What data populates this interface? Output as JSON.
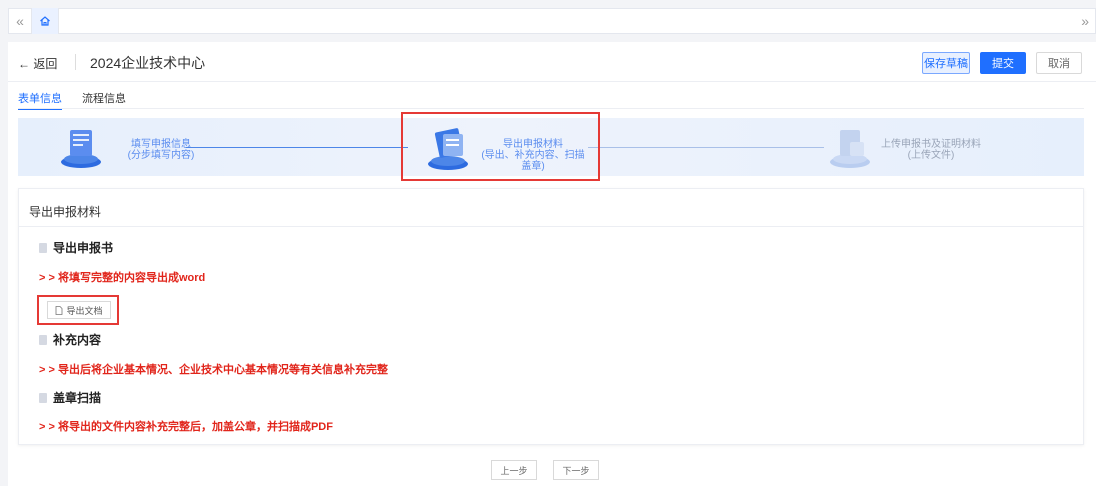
{
  "topbar": {
    "collapse_glyph": "«",
    "expand_glyph": "»"
  },
  "header": {
    "back_label": "← 返回",
    "title": "2024企业技术中心",
    "save_draft_label": "保存草稿",
    "submit_label": "提交",
    "cancel_label": "取消"
  },
  "tabs": [
    {
      "label": "表单信息",
      "active": true
    },
    {
      "label": "流程信息",
      "active": false
    }
  ],
  "steps": [
    {
      "title": "填写申报信息",
      "subtitle": "(分步填写内容)",
      "state": "done"
    },
    {
      "title": "导出申报材料",
      "subtitle": "(导出、补充内容、扫描盖章)",
      "state": "current"
    },
    {
      "title": "上传申报书及证明材料",
      "subtitle": "(上传文件)",
      "state": "pending"
    }
  ],
  "section": {
    "title": "导出申报材料",
    "items": [
      {
        "title": "导出申报书",
        "hint": "> > 将填写完整的内容导出成word"
      },
      {
        "title": "补充内容",
        "hint": "> > 导出后将企业基本情况、企业技术中心基本情况等有关信息补充完整"
      },
      {
        "title": "盖章扫描",
        "hint": "> > 将导出的文件内容补充完整后，加盖公章，并扫描成PDF"
      }
    ],
    "export_button_label": "导出文档"
  },
  "footer": {
    "prev_label": "上一步",
    "next_label": "下一步"
  },
  "colors": {
    "primary": "#1f6fff",
    "hint_red": "#e1251b",
    "highlight_red": "#e53935"
  }
}
